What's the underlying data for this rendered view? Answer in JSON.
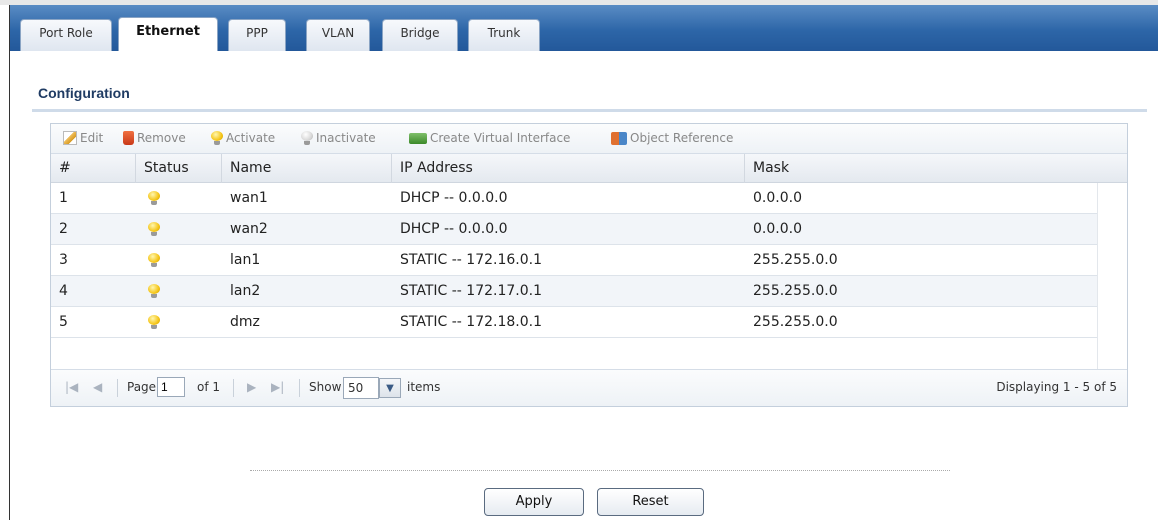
{
  "tabs": [
    {
      "label": "Port Role"
    },
    {
      "label": "Ethernet"
    },
    {
      "label": "PPP"
    },
    {
      "label": "VLAN"
    },
    {
      "label": "Bridge"
    },
    {
      "label": "Trunk"
    }
  ],
  "active_tab": "Ethernet",
  "section": {
    "title": "Configuration"
  },
  "toolbar": {
    "edit": "Edit",
    "remove": "Remove",
    "activate": "Activate",
    "inactivate": "Inactivate",
    "create_virtual": "Create Virtual Interface",
    "object_reference": "Object Reference"
  },
  "table": {
    "headers": {
      "num": "#",
      "status": "Status",
      "name": "Name",
      "ip": "IP Address",
      "mask": "Mask"
    },
    "rows": [
      {
        "num": "1",
        "status": "active-bulb-icon",
        "name": "wan1",
        "ip": "DHCP -- 0.0.0.0",
        "mask": "0.0.0.0"
      },
      {
        "num": "2",
        "status": "active-bulb-icon",
        "name": "wan2",
        "ip": "DHCP -- 0.0.0.0",
        "mask": "0.0.0.0"
      },
      {
        "num": "3",
        "status": "active-bulb-icon",
        "name": "lan1",
        "ip": "STATIC -- 172.16.0.1",
        "mask": "255.255.0.0"
      },
      {
        "num": "4",
        "status": "active-bulb-icon",
        "name": "lan2",
        "ip": "STATIC -- 172.17.0.1",
        "mask": "255.255.0.0"
      },
      {
        "num": "5",
        "status": "active-bulb-icon",
        "name": "dmz",
        "ip": "STATIC -- 172.18.0.1",
        "mask": "255.255.0.0"
      }
    ]
  },
  "pager": {
    "page_label": "Page",
    "page_value": "1",
    "of_label": "of 1",
    "show_label": "Show",
    "show_value": "50",
    "items_label": "items",
    "displaying": "Displaying 1 - 5 of 5"
  },
  "buttons": {
    "apply": "Apply",
    "reset": "Reset"
  },
  "colors": {
    "tabbar": "#2d66a8",
    "section_title": "#1f3b63"
  }
}
